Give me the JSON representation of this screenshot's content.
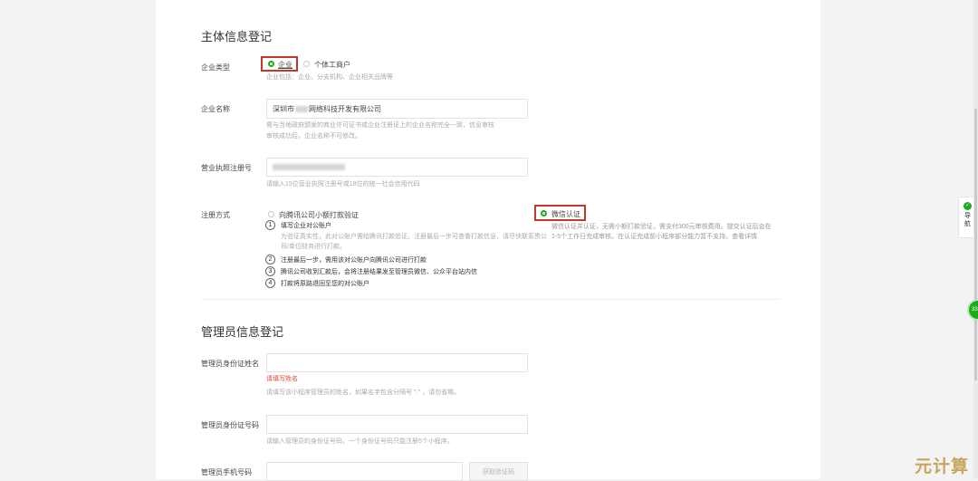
{
  "section1": {
    "title": "主体信息登记",
    "entity_type": {
      "label": "企业类型",
      "option_company": "企业",
      "option_individual": "个体工商户",
      "hint": "企业包括：企业、分支机构、企业相关品牌等"
    },
    "company_name": {
      "label": "企业名称",
      "value_prefix": "深圳市",
      "value_suffix": "网络科技开发有限公司",
      "hint_line1": "需与当地政府颁发的商业许可证书或企业注册证上的企业名称完全一致，信息审核",
      "hint_line2": "审核成功后，企业名称不可修改。"
    },
    "license_no": {
      "label": "营业执照注册号",
      "hint": "请输入15位营业执照注册号或18位的统一社会信用代码"
    },
    "registration": {
      "label": "注册方式",
      "option_transfer": "向腾讯公司小额打款验证",
      "steps": [
        {
          "num": "1",
          "text": "填写企业对公账户",
          "sub": "为验证真实性，此对公账户需给腾讯打款验证。注册最后一步可查看打款信息，请尽快联系贵公司/单位财务进行打款。"
        },
        {
          "num": "2",
          "text": "注册最后一步，需用该对公账户向腾讯公司进行打款"
        },
        {
          "num": "3",
          "text": "腾讯公司收到汇款后，会将注册结果发至管理员微信、公众平台站内信"
        },
        {
          "num": "4",
          "text": "打款将原路退回至您的对公账户"
        }
      ],
      "option_wechat": "微信认证",
      "wechat_desc": "微信认证并认证，无需小额打款验证，需支付300元审核费用。提交认证后会在1-5个工作日完成审核。在认证完成前小程序部分能力暂不支持。查看详情"
    }
  },
  "section2": {
    "title": "管理员信息登记",
    "admin_name": {
      "label": "管理员身份证姓名",
      "error": "请填写姓名",
      "hint": "请填写该小程序管理员的姓名，如果名字包含分隔号 \"·\" ，请勿省略。"
    },
    "admin_id": {
      "label": "管理员身份证号码",
      "hint": "请输入管理员的身份证号码，一个身份证号码只能注册5个小程序。"
    },
    "admin_phone": {
      "label": "管理员手机号码",
      "button": "获取验证码"
    }
  },
  "side_nav": {
    "label": "导航"
  },
  "float_badge": {
    "value": "33"
  },
  "watermark": {
    "text": "元计算"
  },
  "colors": {
    "accent_green": "#1aad19",
    "highlight_red": "#c0392b",
    "error_red": "#e64340"
  }
}
